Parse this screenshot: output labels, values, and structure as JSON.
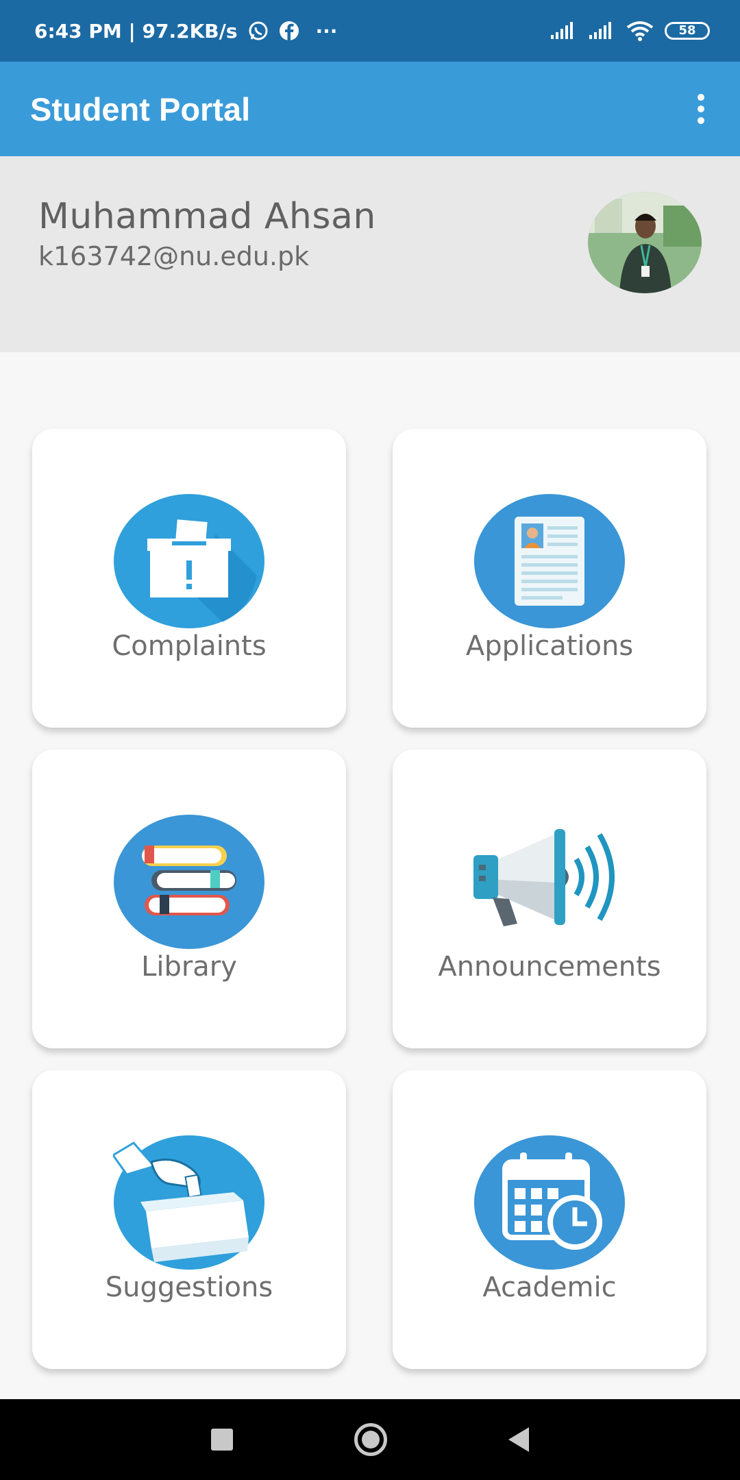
{
  "status_bar": {
    "time_speed": "6:43 PM | 97.2KB/s",
    "more": "···",
    "battery": "58",
    "icons": [
      "whatsapp-icon",
      "facebook-icon",
      "signal-icon",
      "signal-icon",
      "wifi-icon",
      "battery-icon"
    ]
  },
  "app_bar": {
    "title": "Student Portal",
    "menu_icon": "more-vert-icon"
  },
  "profile": {
    "name": "Muhammad Ahsan",
    "email": "k163742@nu.edu.pk"
  },
  "tiles": [
    {
      "label": "Complaints",
      "icon": "complaint-box-icon"
    },
    {
      "label": "Applications",
      "icon": "application-document-icon"
    },
    {
      "label": "Library",
      "icon": "books-icon"
    },
    {
      "label": "Announcements",
      "icon": "megaphone-icon"
    },
    {
      "label": "Suggestions",
      "icon": "suggestion-box-icon"
    },
    {
      "label": "Academic",
      "icon": "calendar-clock-icon"
    }
  ],
  "colors": {
    "status_bar": "#1c6aa3",
    "app_bar": "#3a9bd9",
    "icon_circle": "#3a96d6",
    "profile_bg": "#e8e8e8"
  }
}
